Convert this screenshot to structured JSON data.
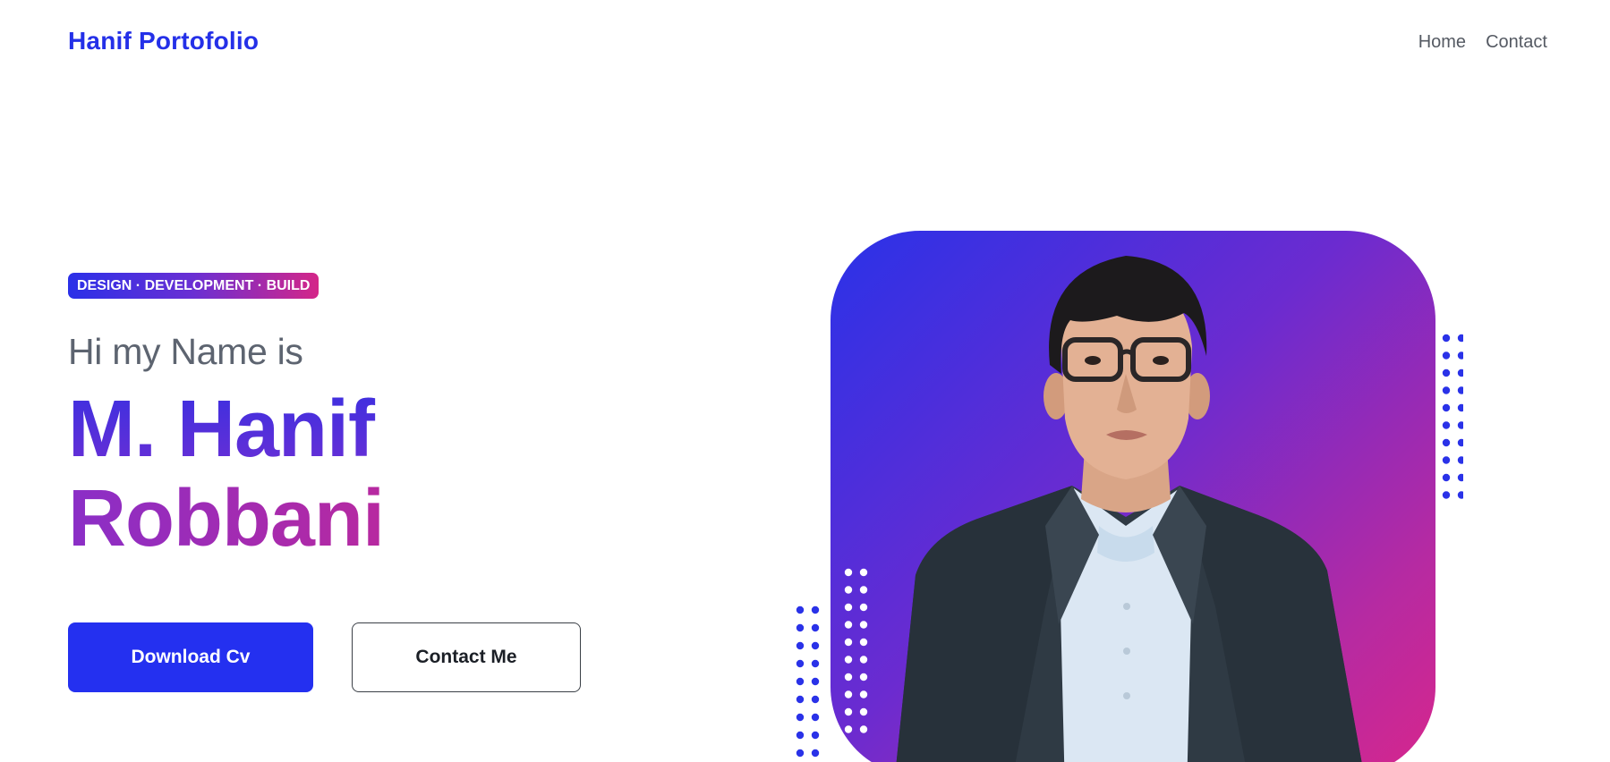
{
  "nav": {
    "brand": "Hanif Portofolio",
    "links": [
      "Home",
      "Contact"
    ]
  },
  "hero": {
    "tagline": "DESIGN · DEVELOPMENT · BUILD",
    "greeting": "Hi my Name is",
    "name_line1": "M. Hanif",
    "name_line2": "Robbani",
    "buttons": {
      "primary": "Download Cv",
      "secondary": "Contact Me"
    }
  },
  "colors": {
    "brand_blue": "#2430e8",
    "gradient_start": "#2a32e8",
    "gradient_mid": "#6b2bd0",
    "gradient_end": "#d7268c"
  },
  "icons": [
    "dot-pattern-decoration",
    "profile-photo"
  ]
}
